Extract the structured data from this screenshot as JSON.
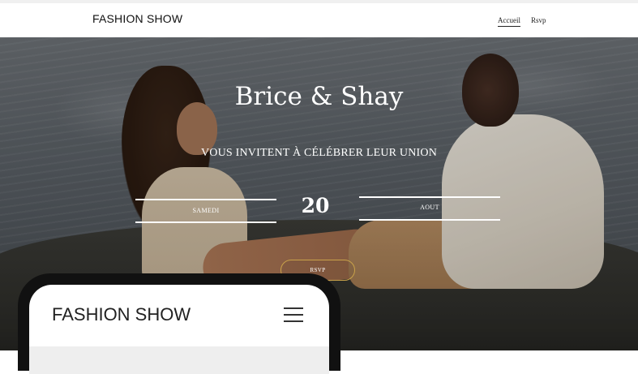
{
  "nav": {
    "brand": "FASHION SHOW",
    "links": [
      "Accueil",
      "Rsvp"
    ]
  },
  "hero": {
    "couple": "Brice & Shay",
    "invite": "VOUS INVITENT À CÉLÉBRER LEUR UNION",
    "date": {
      "day": "SAMEDI",
      "number": "20",
      "month": "AOUT"
    },
    "rsvp_label": "RSVP"
  },
  "mobile": {
    "brand": "FASHION SHOW",
    "menu_icon": "hamburger-menu-icon"
  },
  "colors": {
    "accent": "#c9a24a",
    "text_light": "#ffffff",
    "text_dark": "#111111"
  }
}
